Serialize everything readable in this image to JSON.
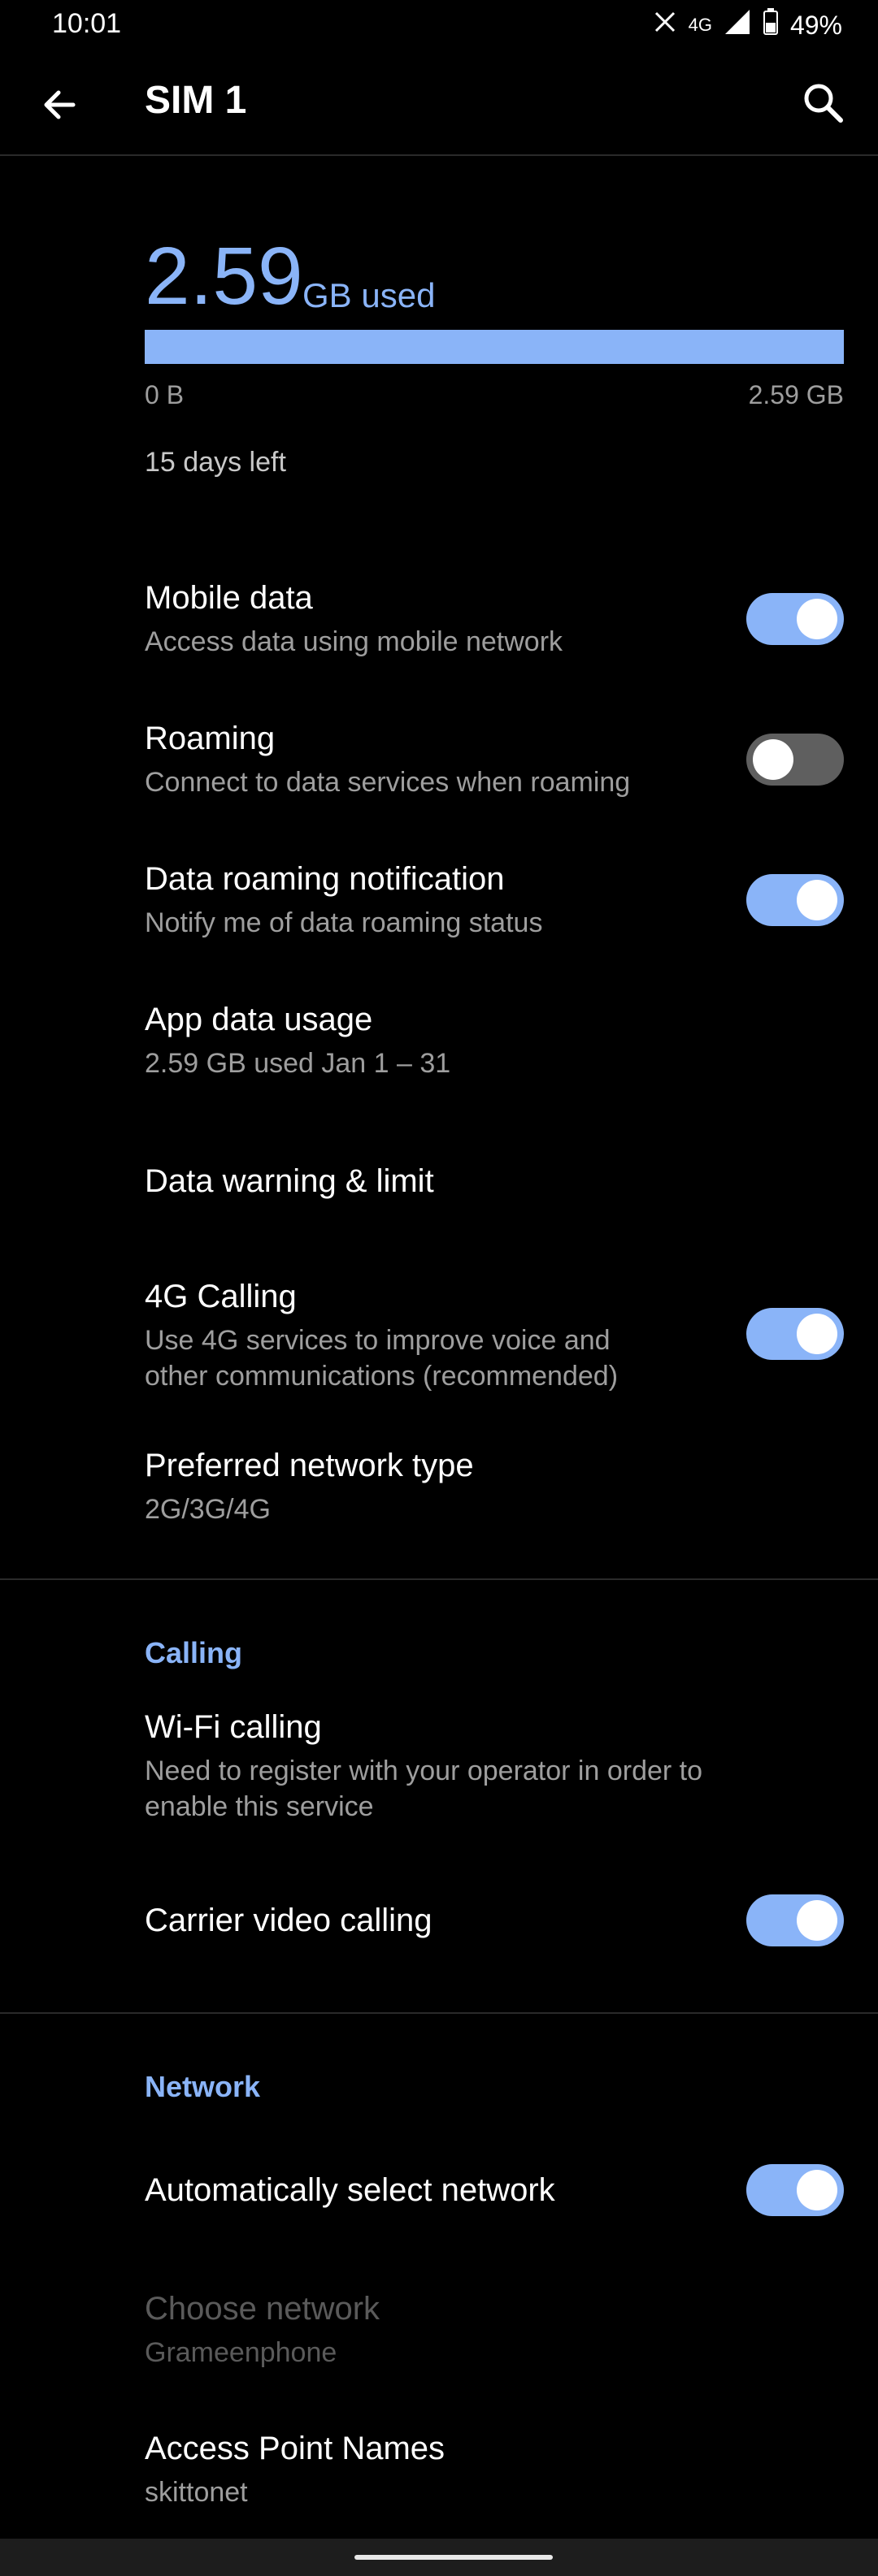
{
  "status_bar": {
    "time": "10:01",
    "network_label": "4G",
    "battery": "49%"
  },
  "app_bar": {
    "title": "SIM 1"
  },
  "usage": {
    "amount": "2.59",
    "unit": "GB used",
    "fill_fraction": 1.0,
    "min_label": "0 B",
    "max_label": "2.59 GB",
    "days_left": "15 days left"
  },
  "settings": {
    "mobile_data": {
      "title": "Mobile data",
      "subtitle": "Access data using mobile network",
      "on": true
    },
    "roaming": {
      "title": "Roaming",
      "subtitle": "Connect to data services when roaming",
      "on": false
    },
    "roaming_notification": {
      "title": "Data roaming notification",
      "subtitle": "Notify me of data roaming status",
      "on": true
    },
    "app_data_usage": {
      "title": "App data usage",
      "subtitle": "2.59 GB used Jan 1 – 31"
    },
    "data_warning": {
      "title": "Data warning & limit"
    },
    "calling_4g": {
      "title": "4G Calling",
      "subtitle_line1": "Use 4G services to improve voice and",
      "subtitle_line2": "other communications (recommended)",
      "on": true
    },
    "preferred_network": {
      "title": "Preferred network type",
      "subtitle": "2G/3G/4G"
    }
  },
  "calling": {
    "header": "Calling",
    "wifi_calling": {
      "title": "Wi-Fi calling",
      "subtitle_line1": "Need to register with your operator in order to",
      "subtitle_line2": "enable this service"
    },
    "carrier_video": {
      "title": "Carrier video calling",
      "on": true
    }
  },
  "network": {
    "header": "Network",
    "auto_select": {
      "title": "Automatically select network",
      "on": true
    },
    "choose_network": {
      "title": "Choose network",
      "subtitle": "Grameenphone",
      "disabled": true
    },
    "apn": {
      "title": "Access Point Names",
      "subtitle": "skittonet"
    }
  },
  "colors": {
    "accent": "#8ab4f8",
    "background": "#000000",
    "secondary_text": "#9e9e9e"
  },
  "icons": [
    "back-arrow-icon",
    "search-icon",
    "signal-icon",
    "battery-icon",
    "no-sim-icon"
  ]
}
